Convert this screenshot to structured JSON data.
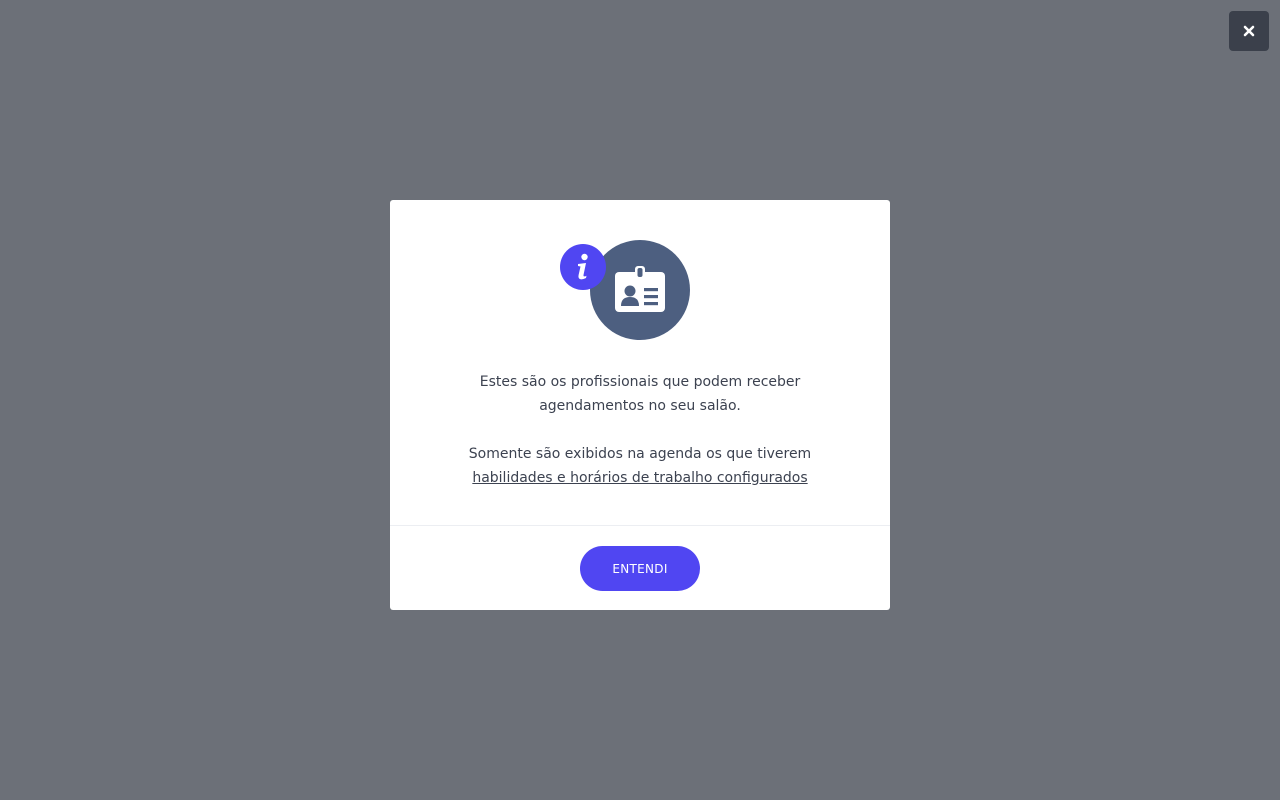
{
  "overlay": {
    "close_icon": "close-icon"
  },
  "modal": {
    "illustration": {
      "main_icon": "id-card-icon",
      "badge_icon": "info-icon",
      "main_color": "#4d5f80",
      "badge_color": "#5046f2"
    },
    "paragraph1": "Estes são os profissionais que podem receber agendamentos no seu salão.",
    "paragraph2_text": "Somente são exibidos na agenda os que tiverem",
    "paragraph2_link": "habilidades e horários de trabalho configurados",
    "confirm_label": "ENTENDI"
  },
  "colors": {
    "backdrop": "#6c7078",
    "accent": "#5046f2",
    "close_button": "#3b404b",
    "text": "#3c4250"
  }
}
